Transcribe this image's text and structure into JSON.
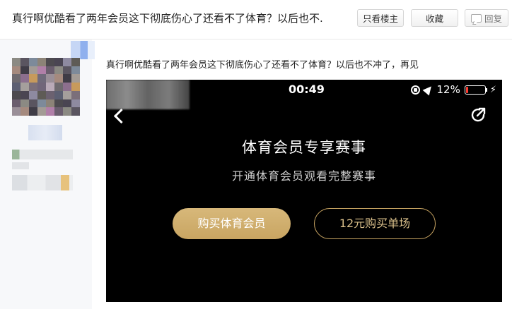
{
  "header": {
    "title": "真行啊优酷看了两年会员这下彻底伤心了还看不了体育？以后也不.",
    "only_host_label": "只看楼主",
    "favorite_label": "收藏",
    "reply_label": "回复"
  },
  "post": {
    "text": "真行啊优酷看了两年会员这下彻底伤心了还看不了体育？以后也不冲了，再见"
  },
  "screenshot": {
    "time": "00:49",
    "battery_percent": "12%",
    "battery_level": 0.12,
    "battery_color": "#ff3b30",
    "title": "体育会员专享赛事",
    "subtitle": "开通体育会员观看完整赛事",
    "buy_member_label": "购买体育会员",
    "buy_single_label": "12元购买单场",
    "accent_color": "#c9a562"
  },
  "icons": [
    "reply-icon",
    "lock-rotation-icon",
    "location-arrow-icon",
    "battery-icon",
    "charging-bolt-icon",
    "back-chevron-icon",
    "share-icon"
  ]
}
